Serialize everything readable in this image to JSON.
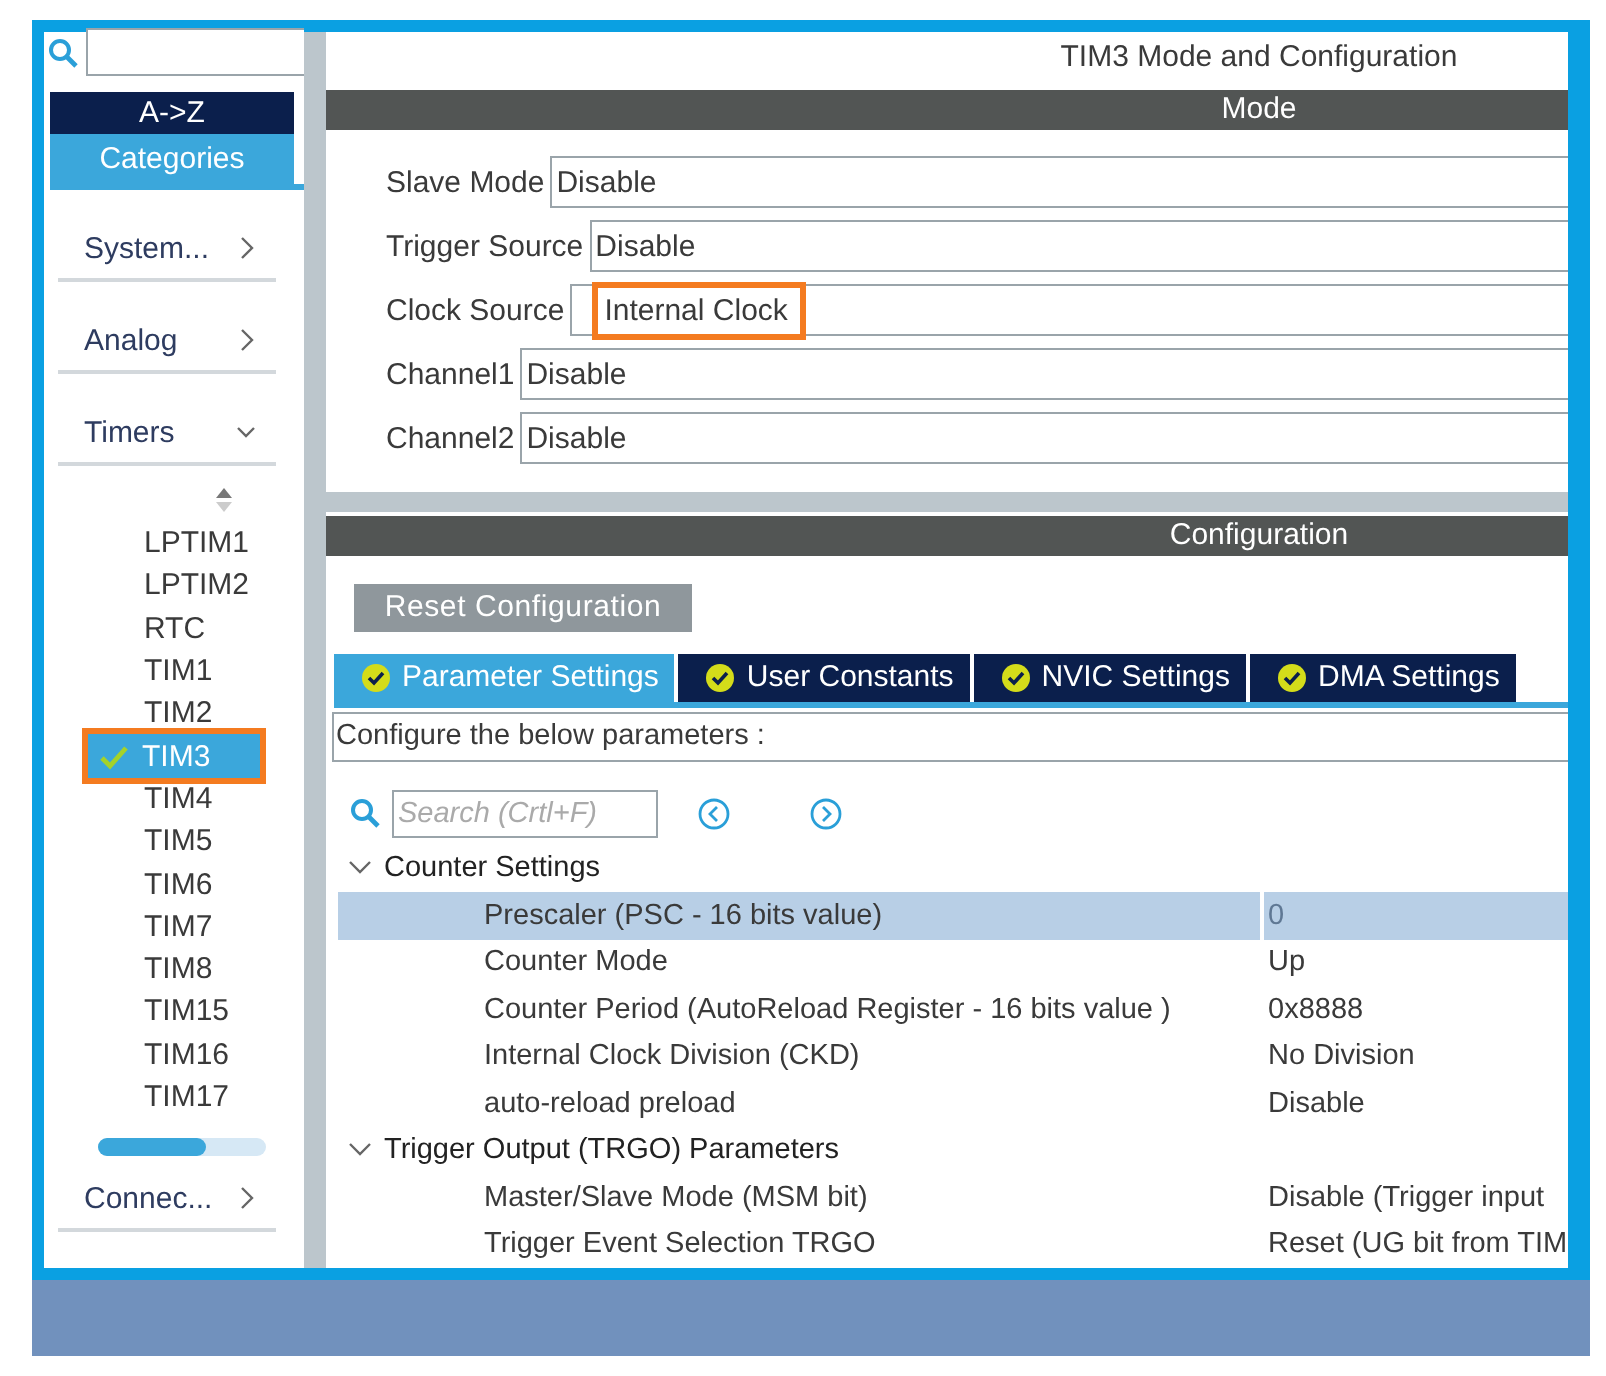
{
  "sidebar": {
    "sort_tabs": [
      {
        "label": "A->Z",
        "selected": false
      },
      {
        "label": "Categories",
        "selected": true
      }
    ],
    "categories": [
      {
        "label": "System...",
        "expanded": false
      },
      {
        "label": "Analog",
        "expanded": false
      },
      {
        "label": "Timers",
        "expanded": true,
        "items": [
          {
            "label": "LPTIM1",
            "selected": false,
            "checked": false,
            "highlighted": false
          },
          {
            "label": "LPTIM2",
            "selected": false,
            "checked": false,
            "highlighted": false
          },
          {
            "label": "RTC",
            "selected": false,
            "checked": false,
            "highlighted": false
          },
          {
            "label": "TIM1",
            "selected": false,
            "checked": false,
            "highlighted": false
          },
          {
            "label": "TIM2",
            "selected": false,
            "checked": false,
            "highlighted": false
          },
          {
            "label": "TIM3",
            "selected": true,
            "checked": true,
            "highlighted": true
          },
          {
            "label": "TIM4",
            "selected": false,
            "checked": false,
            "highlighted": false
          },
          {
            "label": "TIM5",
            "selected": false,
            "checked": false,
            "highlighted": false
          },
          {
            "label": "TIM6",
            "selected": false,
            "checked": false,
            "highlighted": false
          },
          {
            "label": "TIM7",
            "selected": false,
            "checked": false,
            "highlighted": false
          },
          {
            "label": "TIM8",
            "selected": false,
            "checked": false,
            "highlighted": false
          },
          {
            "label": "TIM15",
            "selected": false,
            "checked": false,
            "highlighted": false
          },
          {
            "label": "TIM16",
            "selected": false,
            "checked": false,
            "highlighted": false
          },
          {
            "label": "TIM17",
            "selected": false,
            "checked": false,
            "highlighted": false
          }
        ]
      },
      {
        "label": "Connec...",
        "expanded": false
      }
    ]
  },
  "main": {
    "title": "TIM3 Mode and Configuration",
    "mode": {
      "header": "Mode",
      "fields": [
        {
          "label": "Slave Mode",
          "value": "Disable",
          "highlighted": false
        },
        {
          "label": "Trigger Source",
          "value": "Disable",
          "highlighted": false
        },
        {
          "label": "Clock Source",
          "value": "Internal Clock",
          "highlighted": true
        },
        {
          "label": "Channel1",
          "value": "Disable",
          "highlighted": false
        },
        {
          "label": "Channel2",
          "value": "Disable",
          "highlighted": false
        }
      ]
    },
    "configuration": {
      "header": "Configuration",
      "reset_button": "Reset Configuration",
      "tabs": [
        {
          "label": "Parameter Settings",
          "selected": true
        },
        {
          "label": "User Constants",
          "selected": false
        },
        {
          "label": "NVIC Settings",
          "selected": false
        },
        {
          "label": "DMA Settings",
          "selected": false
        }
      ],
      "description": "Configure the below parameters :",
      "search": {
        "placeholder": "Search (Crtl+F)"
      },
      "groups": [
        {
          "label": "Counter Settings",
          "expanded": true,
          "params": [
            {
              "name": "Prescaler (PSC - 16 bits value)",
              "value": "0",
              "selected": true
            },
            {
              "name": "Counter Mode",
              "value": "Up",
              "selected": false
            },
            {
              "name": "Counter Period (AutoReload Register - 16 bits value )",
              "value": "0x8888",
              "selected": false
            },
            {
              "name": "Internal Clock Division (CKD)",
              "value": "No Division",
              "selected": false
            },
            {
              "name": "auto-reload preload",
              "value": "Disable",
              "selected": false
            }
          ]
        },
        {
          "label": "Trigger Output (TRGO) Parameters",
          "expanded": true,
          "params": [
            {
              "name": "Master/Slave Mode (MSM bit)",
              "value": "Disable (Trigger input",
              "selected": false
            },
            {
              "name": "Trigger Event Selection TRGO",
              "value": "Reset (UG bit from TIM",
              "selected": false
            }
          ]
        }
      ]
    }
  }
}
